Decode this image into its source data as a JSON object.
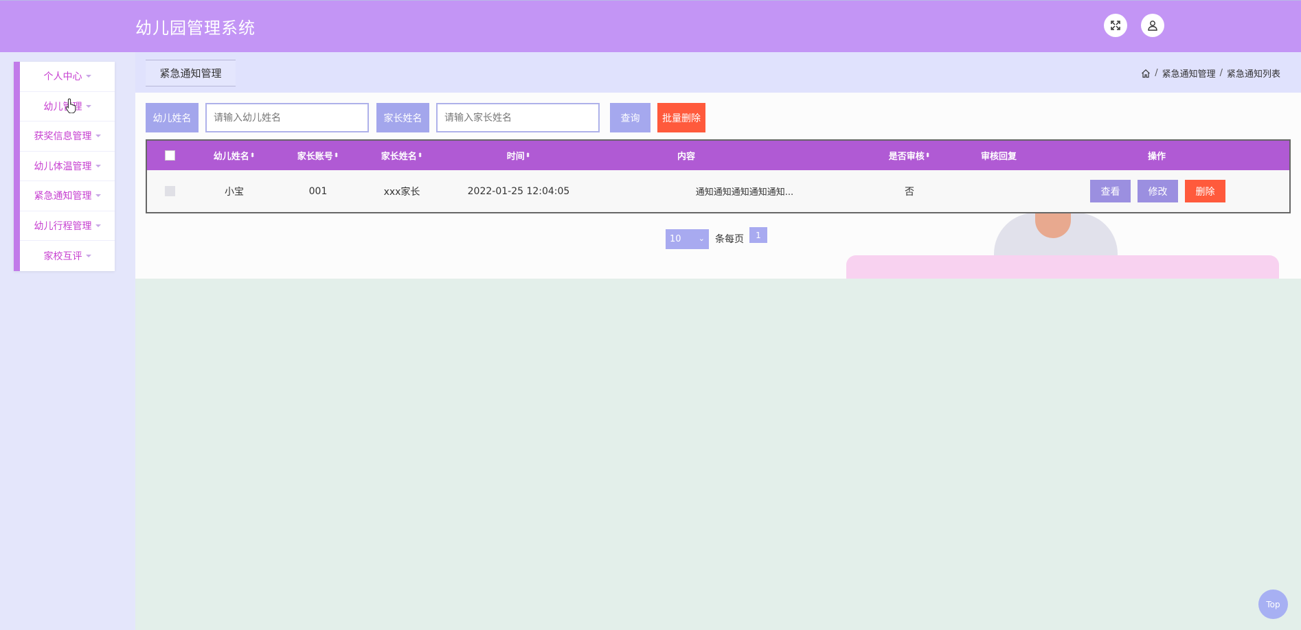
{
  "app": {
    "title": "幼儿园管理系统"
  },
  "header_icons": [
    "fullscreen-icon",
    "user-icon"
  ],
  "sidebar": {
    "items": [
      {
        "label": "个人中心"
      },
      {
        "label": "幼儿管理"
      },
      {
        "label": "获奖信息管理"
      },
      {
        "label": "幼儿体温管理"
      },
      {
        "label": "紧急通知管理"
      },
      {
        "label": "幼儿行程管理"
      },
      {
        "label": "家校互评"
      }
    ]
  },
  "page": {
    "tab": "紧急通知管理"
  },
  "breadcrumb": {
    "items": [
      "紧急通知管理",
      "紧急通知列表"
    ]
  },
  "search": {
    "child_label": "幼儿姓名",
    "child_placeholder": "请输入幼儿姓名",
    "child_value": "",
    "parent_label": "家长姓名",
    "parent_placeholder": "请输入家长姓名",
    "parent_value": "",
    "query_label": "查询",
    "batch_delete_label": "批量删除"
  },
  "table": {
    "columns": [
      "幼儿姓名",
      "家长账号",
      "家长姓名",
      "时间",
      "内容",
      "是否审核",
      "审核回复",
      "操作"
    ],
    "sortable": [
      true,
      true,
      true,
      true,
      false,
      true,
      false,
      false
    ],
    "rows": [
      {
        "child_name": "小宝",
        "parent_account": "001",
        "parent_name": "xxx家长",
        "time": "2022-01-25 12:04:05",
        "content": "通知通知通知通知通知...",
        "audited": "否",
        "audit_reply": "",
        "actions": {
          "view": "查看",
          "edit": "修改",
          "delete": "删除"
        }
      }
    ]
  },
  "pagination": {
    "page_size": "10",
    "per_page_text": "条每页",
    "current_page": "1"
  },
  "back_to_top": "Top",
  "colors": {
    "header": "#c395f5",
    "sidebar_accent": "#c17be9",
    "table_header": "#b05ad4",
    "danger": "#ff5a3c",
    "primary": "#a5a8ee"
  }
}
